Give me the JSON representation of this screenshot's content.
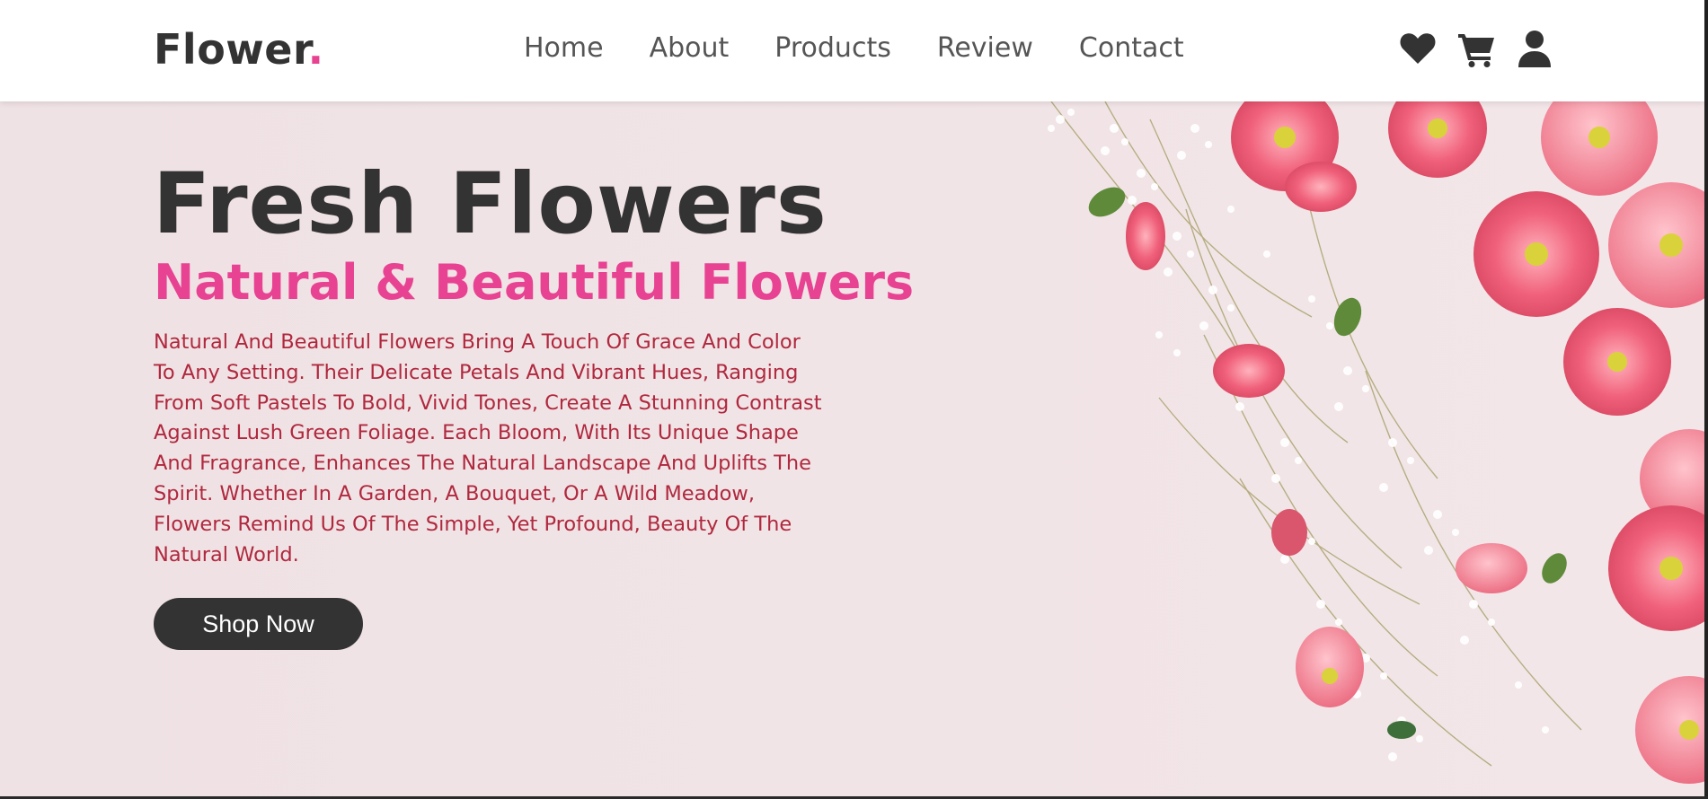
{
  "logo": {
    "text": "Flower",
    "dot": "."
  },
  "nav": {
    "items": [
      "Home",
      "About",
      "Products",
      "Review",
      "Contact"
    ]
  },
  "icons": [
    "heart-icon",
    "cart-icon",
    "user-icon"
  ],
  "hero": {
    "title": "Fresh Flowers",
    "subtitle": "Natural & Beautiful Flowers",
    "text": "Natural And Beautiful Flowers Bring A Touch Of Grace And Color To Any Setting. Their Delicate Petals And Vibrant Hues, Ranging From Soft Pastels To Bold, Vivid Tones, Create A Stunning Contrast Against Lush Green Foliage. Each Bloom, With Its Unique Shape And Fragrance, Enhances The Natural Landscape And Uplifts The Spirit. Whether In A Garden, A Bouquet, Or A Wild Meadow, Flowers Remind Us Of The Simple, Yet Profound, Beauty Of The Natural World.",
    "button": "Shop Now"
  },
  "colors": {
    "accent": "#e84393",
    "dark": "#333333",
    "text_red": "#b0283e",
    "background": "#f0e4e6",
    "flower_pink": "#f0607a"
  }
}
